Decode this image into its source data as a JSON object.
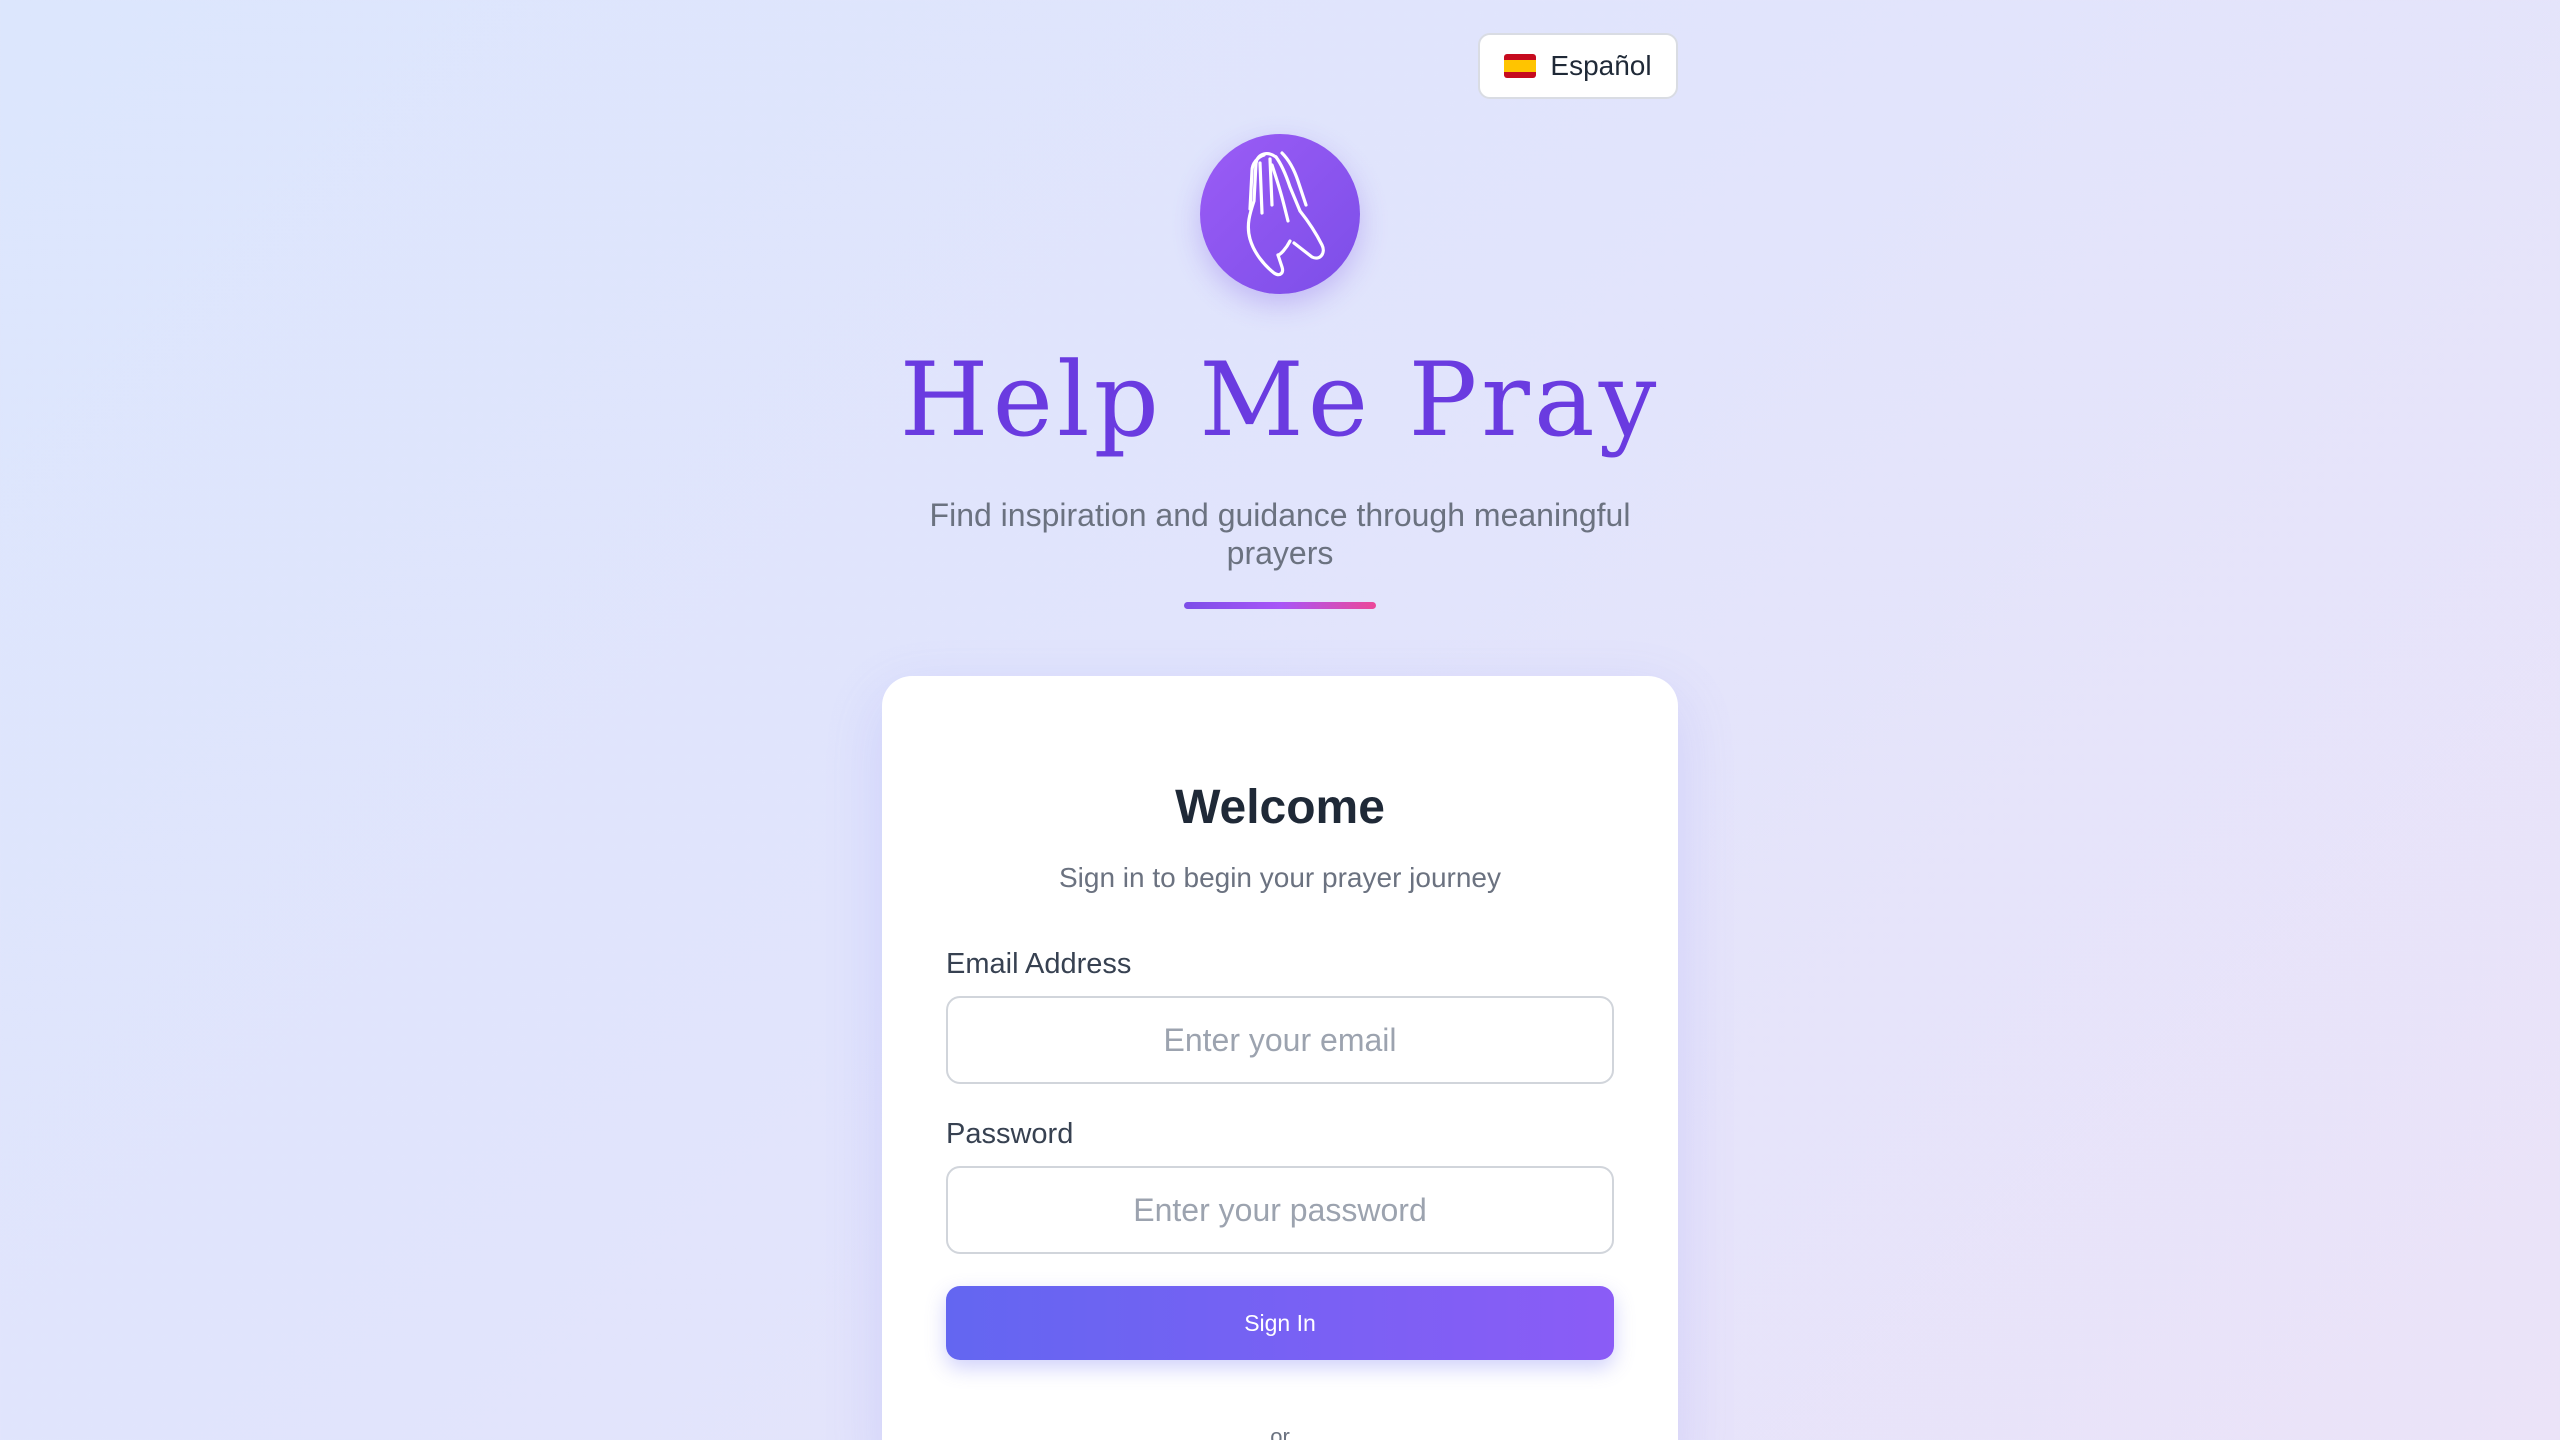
{
  "language_selector": {
    "flag_icon": "spain-flag-icon",
    "label": "Español"
  },
  "brand": {
    "logo_icon": "praying-hands-icon",
    "title": "Help Me Pray",
    "subtitle": "Find inspiration and guidance through meaningful prayers"
  },
  "login_card": {
    "heading": "Welcome",
    "subheading": "Sign in to begin your prayer journey",
    "email": {
      "label": "Email Address",
      "placeholder": "Enter your email",
      "value": ""
    },
    "password": {
      "label": "Password",
      "placeholder": "Enter your password",
      "value": ""
    },
    "sign_in_label": "Sign In",
    "separator_text": "or"
  },
  "colors": {
    "brand_purple": "#6a3be0",
    "button_gradient_start": "#6366f1",
    "button_gradient_end": "#8b5cf6",
    "divider_pink": "#ec4899"
  }
}
